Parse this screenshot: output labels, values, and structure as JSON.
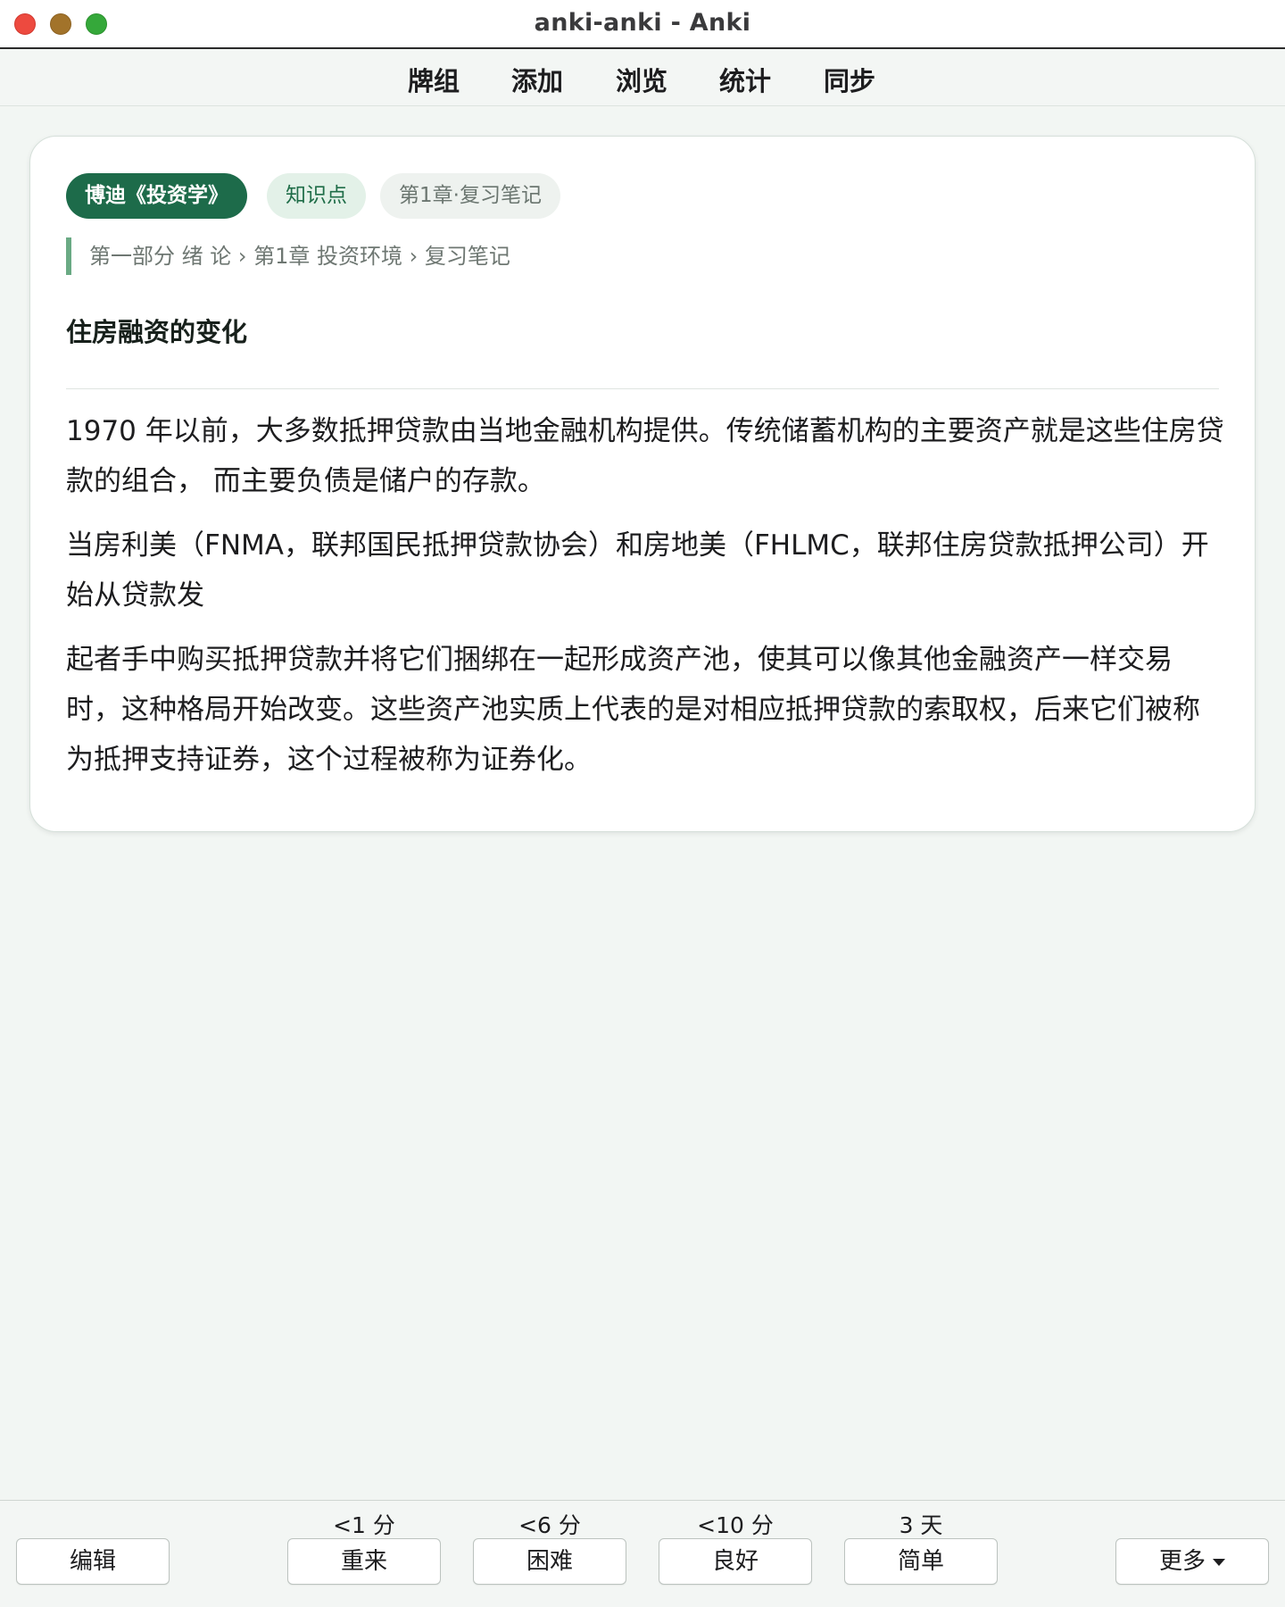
{
  "window": {
    "title": "anki-anki - Anki"
  },
  "toolbar": {
    "items": [
      {
        "label": "牌组"
      },
      {
        "label": "添加"
      },
      {
        "label": "浏览"
      },
      {
        "label": "统计"
      },
      {
        "label": "同步"
      }
    ]
  },
  "card": {
    "tags": [
      "博迪《投资学》",
      "知识点",
      "第1章·复习笔记"
    ],
    "breadcrumb": "第一部分 绪 论 › 第1章 投资环境 › 复习笔记",
    "title": "住房融资的变化",
    "paragraphs": [
      "1970 年以前，大多数抵押贷款由当地金融机构提供。传统储蓄机构的主要资产就是这些住房贷款的组合， 而主要负债是储户的存款。",
      "当房利美（FNMA，联邦国民抵押贷款协会）和房地美（FHLMC，联邦住房贷款抵押公司）开始从贷款发",
      "起者手中购买抵押贷款并将它们捆绑在一起形成资产池，使其可以像其他金融资产一样交易时，这种格局开始改变。这些资产池实质上代表的是对相应抵押贷款的索取权，后来它们被称为抵押支持证券，这个过程被称为证券化。"
    ]
  },
  "answer_bar": {
    "edit_label": "编辑",
    "more_label": "更多",
    "buttons": [
      {
        "interval": "<1 分",
        "label": "重来"
      },
      {
        "interval": "<6 分",
        "label": "困难"
      },
      {
        "interval": "<10 分",
        "label": "良好"
      },
      {
        "interval": "3 天",
        "label": "简单"
      }
    ]
  },
  "colors": {
    "accent": "#1d6b4a",
    "tag_secondary_bg": "#e3f1e8",
    "breadcrumb_bar": "#6aaa84",
    "close": "#ed4a3f",
    "minimize": "#a2732a",
    "maximize": "#35a83a"
  }
}
